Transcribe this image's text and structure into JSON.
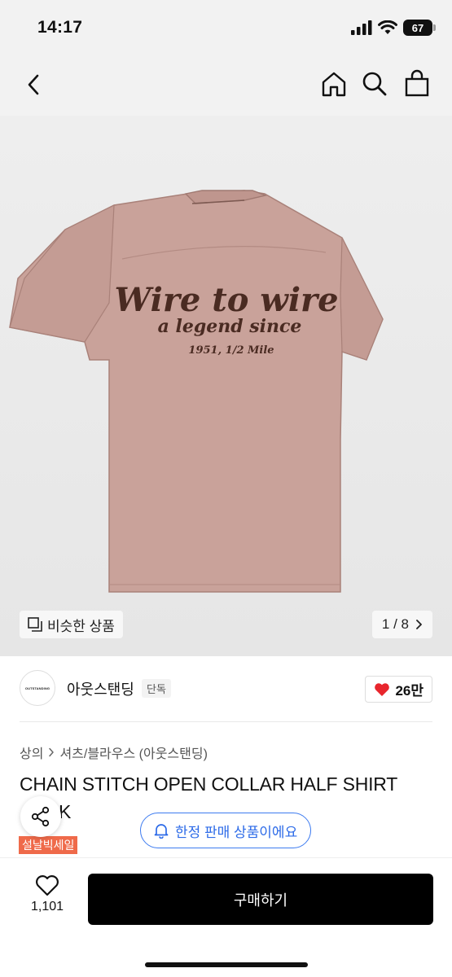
{
  "status_bar": {
    "time": "14:17",
    "battery": "67"
  },
  "nav": {
    "icons": [
      "back-chevron-icon",
      "home-icon",
      "search-icon",
      "shopping-bag-icon"
    ]
  },
  "gallery": {
    "embroidery_line1": "Wire to wire",
    "embroidery_line2": "a legend since",
    "embroidery_line3": "1951, 1/2 Mile",
    "similar_label": "비슷한 상품",
    "counter": "1 / 8",
    "shirt_color": "#c9a29a",
    "embroidery_color": "#4a2b22"
  },
  "brand": {
    "logo_text": "OUTSTANDING",
    "name": "아웃스탠딩",
    "exclusive_tag": "단독",
    "likes": "26만"
  },
  "product": {
    "breadcrumb": [
      "상의",
      "셔츠/블라우스 (아웃스탠딩)"
    ],
    "title": "CHAIN STITCH OPEN COLLAR HALF SHIRT",
    "title_tail": "K",
    "limited_notice": "한정 판매 상품이에요",
    "sale_badge": "설날빅세일"
  },
  "bottom": {
    "wishlist_count": "1,101",
    "buy_label": "구매하기"
  },
  "colors": {
    "accent_blue": "#2d6be8",
    "heart_red": "#e8262d",
    "sale_orange": "#ef6a4a"
  }
}
